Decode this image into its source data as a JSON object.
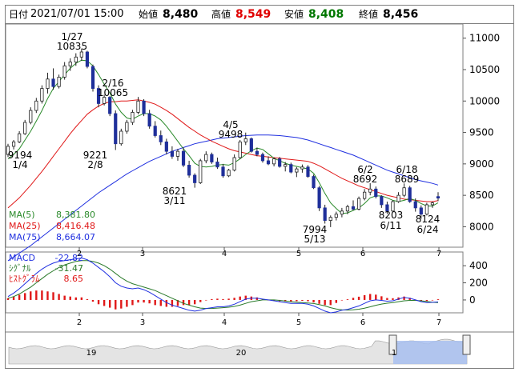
{
  "header": {
    "date_label": "日付",
    "datetime": "2021/07/01 15:00",
    "open_label": "始値",
    "open": "8,480",
    "high_label": "高値",
    "high": "8,549",
    "low_label": "安値",
    "low": "8,408",
    "close_label": "終値",
    "close": "8,456"
  },
  "colors": {
    "up": "#ffffff",
    "down": "#1f2f9a",
    "ma5": "#2a8a2a",
    "ma25": "#e01818",
    "ma75": "#2030e0",
    "high_value": "#e00000",
    "low_value": "#007700",
    "macd": "#2030e0",
    "signal": "#2a7a2a",
    "histogram": "#e01818",
    "navigator_fill": "#a8bff0"
  },
  "legend": [
    {
      "label": "MA(5)",
      "value": "8,381.80"
    },
    {
      "label": "MA(25)",
      "value": "8,416.48"
    },
    {
      "label": "MA(75)",
      "value": "8,664.07"
    }
  ],
  "macd_legend": [
    {
      "label": "MACD",
      "value": "-22.82"
    },
    {
      "label": "ｼｸﾞﾅﾙ",
      "value": "-31.47"
    },
    {
      "label": "ﾋｽﾄｸﾞﾗﾑ",
      "value": "8.65"
    }
  ],
  "annotations": [
    {
      "date": "1/27",
      "value": "10835"
    },
    {
      "date": "2/16",
      "value": "10065"
    },
    {
      "date": "4/5",
      "value": "9498"
    },
    {
      "date": "6/2",
      "value": "8692"
    },
    {
      "date": "6/18",
      "value": "8689"
    },
    {
      "date": "1/4",
      "value": "9194"
    },
    {
      "date": "2/8",
      "value": "9221"
    },
    {
      "date": "3/11",
      "value": "8621"
    },
    {
      "date": "5/13",
      "value": "7994"
    },
    {
      "date": "6/11",
      "value": "8203"
    },
    {
      "date": "6/24",
      "value": "8124"
    }
  ],
  "navigator": {
    "labels": [
      "19",
      "20",
      "1"
    ]
  },
  "chart_data": {
    "type": "candlestick",
    "ylim": [
      7700,
      11200
    ],
    "yticks": [
      "11000",
      "10500",
      "10000",
      "9500",
      "9000",
      "8500",
      "8000"
    ],
    "xticks": [
      "2",
      "3",
      "4",
      "5",
      "6",
      "7"
    ],
    "macd_ylim": [
      -150,
      560
    ],
    "macd_yticks": [
      "400",
      "200",
      "0"
    ],
    "candles": [
      [
        9150,
        9320,
        9110,
        9280
      ],
      [
        9280,
        9380,
        9230,
        9350
      ],
      [
        9350,
        9520,
        9330,
        9480
      ],
      [
        9480,
        9700,
        9460,
        9660
      ],
      [
        9660,
        9900,
        9630,
        9850
      ],
      [
        9850,
        10050,
        9810,
        10000
      ],
      [
        10000,
        10250,
        9960,
        10200
      ],
      [
        10200,
        10450,
        10120,
        10350
      ],
      [
        10350,
        10520,
        10180,
        10230
      ],
      [
        10230,
        10420,
        10200,
        10380
      ],
      [
        10380,
        10620,
        10340,
        10560
      ],
      [
        10560,
        10680,
        10480,
        10620
      ],
      [
        10620,
        10760,
        10560,
        10700
      ],
      [
        10700,
        10835,
        10640,
        10780
      ],
      [
        10780,
        10800,
        10520,
        10550
      ],
      [
        10550,
        10580,
        10150,
        10200
      ],
      [
        10200,
        10250,
        9900,
        9960
      ],
      [
        9960,
        10100,
        9930,
        10060
      ],
      [
        10060,
        10080,
        9760,
        9800
      ],
      [
        9800,
        9850,
        9221,
        9320
      ],
      [
        9320,
        9560,
        9290,
        9520
      ],
      [
        9520,
        9700,
        9480,
        9660
      ],
      [
        9660,
        9860,
        9620,
        9820
      ],
      [
        9820,
        10065,
        9790,
        10000
      ],
      [
        10000,
        10030,
        9760,
        9800
      ],
      [
        9800,
        9860,
        9560,
        9600
      ],
      [
        9600,
        9680,
        9420,
        9450
      ],
      [
        9450,
        9530,
        9300,
        9350
      ],
      [
        9350,
        9400,
        9150,
        9200
      ],
      [
        9200,
        9280,
        9080,
        9120
      ],
      [
        9120,
        9240,
        9050,
        9200
      ],
      [
        9200,
        9260,
        8950,
        8980
      ],
      [
        8980,
        9050,
        8780,
        8820
      ],
      [
        8820,
        8850,
        8621,
        8700
      ],
      [
        8700,
        9080,
        8680,
        9050
      ],
      [
        9050,
        9200,
        9010,
        9150
      ],
      [
        9150,
        9180,
        9000,
        9030
      ],
      [
        9030,
        9100,
        8920,
        8950
      ],
      [
        8950,
        9000,
        8780,
        8810
      ],
      [
        8810,
        8920,
        8790,
        8900
      ],
      [
        8900,
        9150,
        8880,
        9100
      ],
      [
        9100,
        9380,
        9080,
        9350
      ],
      [
        9350,
        9498,
        9300,
        9400
      ],
      [
        9400,
        9420,
        9180,
        9200
      ],
      [
        9200,
        9260,
        9120,
        9150
      ],
      [
        9150,
        9180,
        9020,
        9050
      ],
      [
        9050,
        9120,
        8980,
        9000
      ],
      [
        9000,
        9100,
        8960,
        9080
      ],
      [
        9080,
        9110,
        8940,
        8960
      ],
      [
        8960,
        9030,
        8880,
        8990
      ],
      [
        8990,
        9020,
        8850,
        8870
      ],
      [
        8870,
        8950,
        8790,
        8920
      ],
      [
        8920,
        8990,
        8860,
        8950
      ],
      [
        8950,
        8980,
        8780,
        8800
      ],
      [
        8800,
        8830,
        8600,
        8620
      ],
      [
        8620,
        8650,
        8250,
        8300
      ],
      [
        8300,
        8350,
        8050,
        8100
      ],
      [
        8100,
        8180,
        7994,
        8150
      ],
      [
        8150,
        8240,
        8100,
        8200
      ],
      [
        8200,
        8300,
        8150,
        8250
      ],
      [
        8250,
        8350,
        8200,
        8320
      ],
      [
        8320,
        8420,
        8260,
        8280
      ],
      [
        8280,
        8480,
        8260,
        8450
      ],
      [
        8450,
        8600,
        8420,
        8550
      ],
      [
        8550,
        8692,
        8500,
        8600
      ],
      [
        8600,
        8640,
        8450,
        8480
      ],
      [
        8480,
        8500,
        8300,
        8350
      ],
      [
        8350,
        8400,
        8203,
        8250
      ],
      [
        8250,
        8420,
        8230,
        8400
      ],
      [
        8400,
        8550,
        8380,
        8500
      ],
      [
        8500,
        8689,
        8470,
        8620
      ],
      [
        8620,
        8650,
        8380,
        8400
      ],
      [
        8400,
        8450,
        8240,
        8300
      ],
      [
        8300,
        8340,
        8124,
        8200
      ],
      [
        8200,
        8380,
        8180,
        8350
      ],
      [
        8350,
        8400,
        8300,
        8380
      ],
      [
        8480,
        8549,
        8408,
        8456
      ]
    ],
    "ma5": [
      9080,
      9150,
      9240,
      9380,
      9520,
      9680,
      9850,
      10040,
      10200,
      10310,
      10420,
      10520,
      10600,
      10650,
      10640,
      10560,
      10420,
      10270,
      10130,
      9950,
      9820,
      9730,
      9710,
      9760,
      9800,
      9800,
      9760,
      9700,
      9600,
      9480,
      9360,
      9240,
      9130,
      9010,
      8960,
      8950,
      8960,
      8980,
      8990,
      8980,
      9020,
      9080,
      9150,
      9210,
      9250,
      9230,
      9160,
      9090,
      9050,
      9010,
      8980,
      8960,
      8940,
      8920,
      8850,
      8700,
      8530,
      8380,
      8290,
      8210,
      8220,
      8260,
      8300,
      8370,
      8460,
      8490,
      8490,
      8460,
      8420,
      8400,
      8420,
      8450,
      8420,
      8370,
      8330,
      8330,
      8381
    ],
    "ma25": [
      8300,
      8380,
      8460,
      8560,
      8660,
      8770,
      8880,
      9000,
      9120,
      9240,
      9360,
      9480,
      9590,
      9690,
      9790,
      9860,
      9920,
      9960,
      9990,
      9990,
      10000,
      10000,
      10010,
      10020,
      10000,
      9980,
      9950,
      9900,
      9850,
      9790,
      9720,
      9650,
      9580,
      9520,
      9460,
      9410,
      9360,
      9320,
      9280,
      9240,
      9210,
      9190,
      9170,
      9150,
      9130,
      9120,
      9110,
      9100,
      9090,
      9080,
      9070,
      9060,
      9050,
      9040,
      9010,
      8970,
      8920,
      8870,
      8820,
      8770,
      8730,
      8690,
      8650,
      8620,
      8590,
      8560,
      8530,
      8500,
      8480,
      8460,
      8440,
      8430,
      8420,
      8410,
      8400,
      8400,
      8416
    ],
    "ma75": [
      7460,
      7520,
      7580,
      7640,
      7700,
      7770,
      7840,
      7910,
      7980,
      8050,
      8120,
      8190,
      8260,
      8330,
      8400,
      8470,
      8540,
      8600,
      8660,
      8720,
      8780,
      8840,
      8890,
      8940,
      8990,
      9040,
      9080,
      9120,
      9160,
      9200,
      9230,
      9260,
      9290,
      9320,
      9340,
      9360,
      9380,
      9400,
      9410,
      9420,
      9430,
      9440,
      9450,
      9455,
      9460,
      9460,
      9460,
      9455,
      9450,
      9440,
      9430,
      9420,
      9400,
      9380,
      9350,
      9320,
      9290,
      9260,
      9230,
      9200,
      9170,
      9140,
      9100,
      9060,
      9020,
      8980,
      8940,
      8900,
      8870,
      8840,
      8810,
      8780,
      8750,
      8730,
      8710,
      8690,
      8664
    ],
    "macd": [
      40,
      80,
      130,
      190,
      250,
      310,
      360,
      400,
      430,
      450,
      460,
      470,
      480,
      490,
      470,
      430,
      380,
      330,
      270,
      200,
      160,
      140,
      130,
      140,
      120,
      90,
      50,
      10,
      -30,
      -60,
      -80,
      -100,
      -120,
      -130,
      -120,
      -100,
      -90,
      -80,
      -80,
      -70,
      -50,
      -20,
      10,
      20,
      20,
      10,
      0,
      -10,
      -20,
      -30,
      -40,
      -40,
      -40,
      -50,
      -70,
      -100,
      -130,
      -150,
      -140,
      -120,
      -110,
      -90,
      -70,
      -40,
      -10,
      0,
      -5,
      -15,
      -10,
      10,
      30,
      20,
      0,
      -20,
      -30,
      -28,
      -23
    ],
    "signal": [
      20,
      40,
      70,
      110,
      150,
      200,
      250,
      300,
      340,
      380,
      410,
      430,
      450,
      460,
      460,
      450,
      430,
      400,
      360,
      310,
      260,
      220,
      190,
      170,
      150,
      130,
      110,
      80,
      50,
      20,
      -10,
      -40,
      -60,
      -80,
      -95,
      -100,
      -100,
      -95,
      -90,
      -85,
      -75,
      -60,
      -40,
      -20,
      -10,
      0,
      0,
      0,
      -5,
      -12,
      -20,
      -26,
      -30,
      -35,
      -42,
      -55,
      -70,
      -90,
      -105,
      -115,
      -118,
      -115,
      -108,
      -96,
      -80,
      -62,
      -48,
      -38,
      -30,
      -20,
      -10,
      -5,
      -5,
      -10,
      -18,
      -26,
      -31
    ]
  }
}
